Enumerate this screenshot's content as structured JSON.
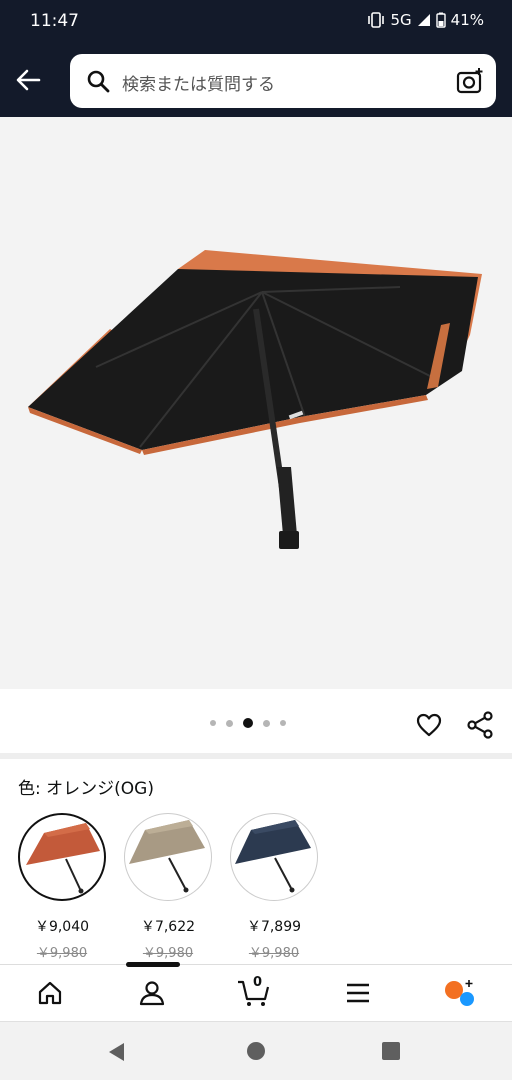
{
  "status_bar": {
    "time": "11:47",
    "network": "5G",
    "battery": "41%"
  },
  "search": {
    "placeholder": "検索または質問する"
  },
  "gallery": {
    "image_count": 5,
    "active_index": 2
  },
  "variant": {
    "label": "色: オレンジ(OG)",
    "options": [
      {
        "color": "#c35a3a",
        "price": "￥9,040",
        "list_price": "￥9,980",
        "selected": true
      },
      {
        "color": "#a89a84",
        "price": "￥7,622",
        "list_price": "￥9,980",
        "selected": false
      },
      {
        "color": "#2c3a50",
        "price": "￥7,899",
        "list_price": "￥9,980",
        "selected": false
      }
    ]
  },
  "bottom_nav": {
    "cart_count": "0"
  },
  "colors": {
    "header_bg": "#131a2a",
    "umbrella_trim": "#d9794a",
    "umbrella_canopy": "#1a1a1a"
  }
}
